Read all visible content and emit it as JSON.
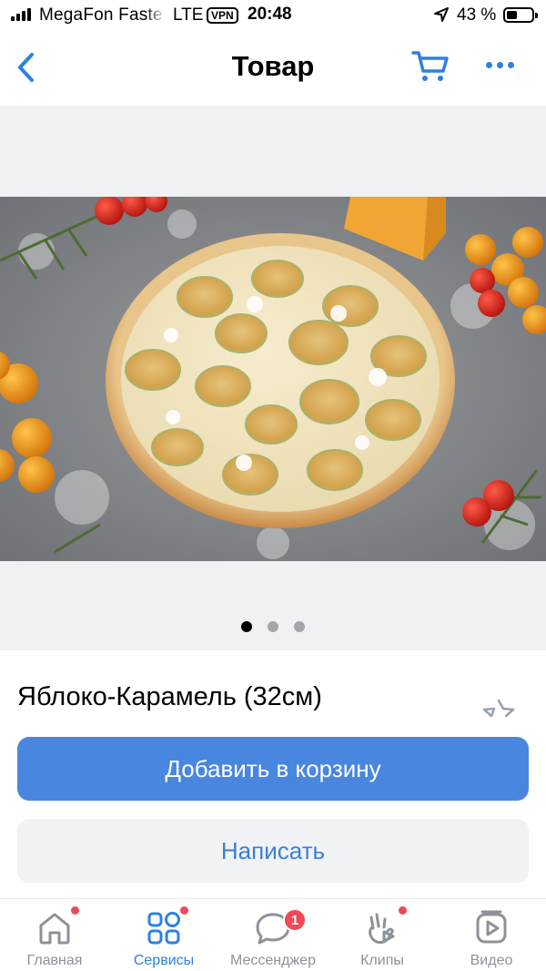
{
  "status_bar": {
    "carrier": "MegaFon Faste",
    "network": "LTE",
    "vpn": "VPN",
    "time": "20:48",
    "battery_percent": "43 %",
    "battery_level": 0.43
  },
  "header": {
    "title": "Товар",
    "back_icon": "chevron-left-icon",
    "cart_icon": "cart-icon",
    "more_icon": "more-dots-icon"
  },
  "gallery": {
    "image": "pizza-photo",
    "total_slides": 3,
    "active_slide": 1
  },
  "product": {
    "name": "Яблоко-Карамель (32см)",
    "favorite_icon": "star-outline-icon"
  },
  "actions": {
    "add_to_cart": "Добавить в корзину",
    "write": "Написать"
  },
  "tabbar": {
    "items": [
      {
        "label": "Главная",
        "icon": "home-icon",
        "active": false,
        "has_dot": true
      },
      {
        "label": "Сервисы",
        "icon": "services-grid-icon",
        "active": true,
        "has_dot": true
      },
      {
        "label": "Мессенджер",
        "icon": "chat-bubble-icon",
        "active": false,
        "badge": "1"
      },
      {
        "label": "Клипы",
        "icon": "clips-icon",
        "active": false,
        "has_dot": true
      },
      {
        "label": "Видео",
        "icon": "video-icon",
        "active": false
      }
    ]
  },
  "colors": {
    "accent": "#2d81e0",
    "primary_button": "#4986e0",
    "notification": "#f04858"
  }
}
